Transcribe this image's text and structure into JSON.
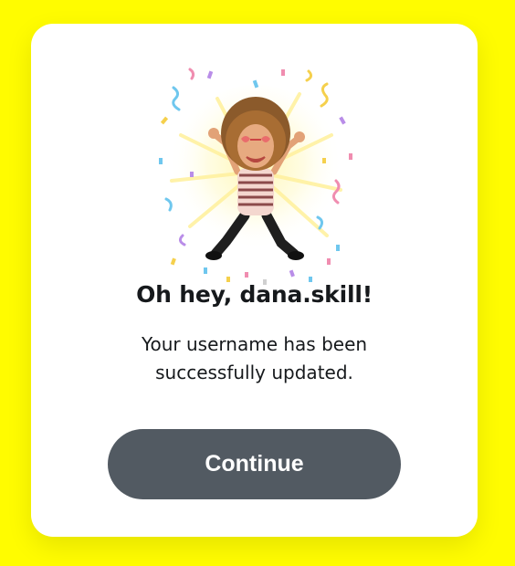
{
  "dialog": {
    "title": "Oh hey, dana.skill!",
    "message": "Your username has been successfully updated.",
    "continue_label": "Continue"
  },
  "illustration": {
    "name": "bitmoji-celebration-icon"
  },
  "colors": {
    "background": "#FFFC00",
    "card": "#FFFFFF",
    "button": "#525A62",
    "text": "#16191C"
  }
}
